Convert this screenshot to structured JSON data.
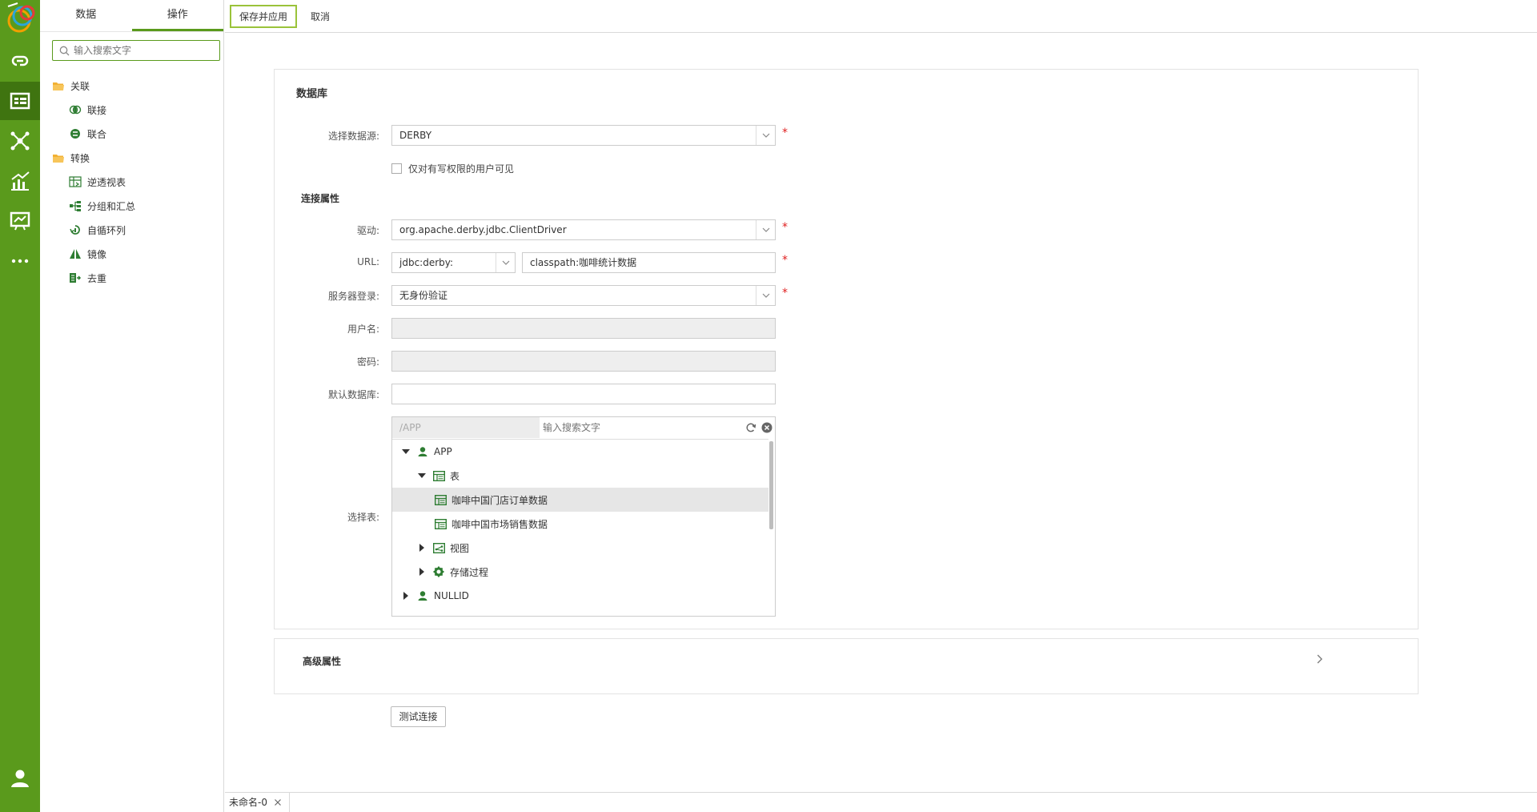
{
  "rail": {
    "items": [
      "link-icon",
      "dataset-icon",
      "network-icon",
      "chart-icon",
      "dashboard-icon",
      "more-icon"
    ],
    "active": "dataset-icon",
    "user": "user-icon"
  },
  "side": {
    "tabs": [
      {
        "label": "数据"
      },
      {
        "label": "操作"
      }
    ],
    "search_placeholder": "输入搜索文字",
    "groups": [
      {
        "label": "关联",
        "icon": "folder-icon",
        "children": [
          {
            "label": "联接",
            "icon": "join-icon"
          },
          {
            "label": "联合",
            "icon": "union-icon"
          }
        ]
      },
      {
        "label": "转换",
        "icon": "folder-icon",
        "children": [
          {
            "label": "逆透视表",
            "icon": "unpivot-icon"
          },
          {
            "label": "分组和汇总",
            "icon": "group-icon"
          },
          {
            "label": "自循环列",
            "icon": "loop-icon"
          },
          {
            "label": "镜像",
            "icon": "mirror-icon"
          },
          {
            "label": "去重",
            "icon": "dedupe-icon"
          }
        ]
      }
    ]
  },
  "toolbar": {
    "save_label": "保存并应用",
    "cancel_label": "取消"
  },
  "form": {
    "section_title": "数据库",
    "datasource_label": "选择数据源:",
    "datasource_value": "DERBY",
    "write_only_label": "仅对有写权限的用户可见",
    "conn_title": "连接属性",
    "driver_label": "驱动:",
    "driver_value": "org.apache.derby.jdbc.ClientDriver",
    "url_label": "URL:",
    "url_prefix": "jdbc:derby:",
    "url_value": "classpath:咖啡统计数据",
    "login_label": "服务器登录:",
    "login_value": "无身份验证",
    "username_label": "用户名:",
    "password_label": "密码:",
    "default_db_label": "默认数据库:",
    "select_table_label": "选择表:",
    "required_mark": "*"
  },
  "table_selector": {
    "path": "/APP",
    "search_placeholder": "输入搜索文字",
    "rows": [
      {
        "label": "APP",
        "icon": "schema-icon",
        "arrow": "expanded",
        "level": 0
      },
      {
        "label": "表",
        "icon": "table-icon",
        "arrow": "expanded",
        "level": 1
      },
      {
        "label": "咖啡中国门店订单数据",
        "icon": "table-icon",
        "arrow": "none",
        "level": 2,
        "selected": true
      },
      {
        "label": "咖啡中国市场销售数据",
        "icon": "table-icon",
        "arrow": "none",
        "level": 2
      },
      {
        "label": "视图",
        "icon": "view-icon",
        "arrow": "collapsed",
        "level": 1
      },
      {
        "label": "存储过程",
        "icon": "procedure-icon",
        "arrow": "collapsed",
        "level": 1
      },
      {
        "label": "NULLID",
        "icon": "schema-icon",
        "arrow": "collapsed",
        "level": 0
      }
    ]
  },
  "advanced": {
    "title": "高级属性"
  },
  "test_button": "测试连接",
  "bottom_tab": {
    "label": "未命名-0"
  },
  "colors": {
    "brand": "#5a9a1c",
    "brand_dark": "#3f7410",
    "required": "#e02020",
    "highlight_border": "#9ac33a"
  }
}
